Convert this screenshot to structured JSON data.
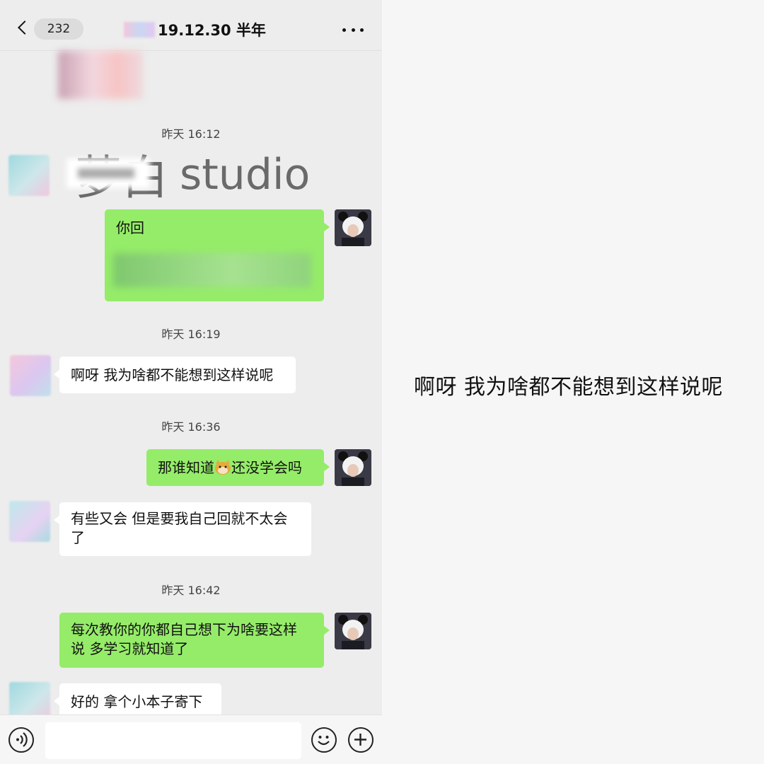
{
  "header": {
    "unread_count": "232",
    "title": "19.12.30 半年"
  },
  "sticker_text": "studio",
  "timestamps": [
    "昨天 16:12",
    "昨天 16:19",
    "昨天 16:36",
    "昨天 16:42"
  ],
  "messages": [
    {
      "side": "out",
      "text": "你回"
    },
    {
      "side": "in",
      "text": "啊呀 我为啥都不能想到这样说呢"
    },
    {
      "side": "out",
      "text_before_emoji": "那谁知道",
      "emoji": "doge-emoji",
      "text_after_emoji": "还没学会吗"
    },
    {
      "side": "in",
      "line1": "有些又会 但是要我自己回就不太会",
      "line2": "了"
    },
    {
      "side": "out",
      "line1": "每次教你的你都自己想下为啥要这样",
      "line2": "说 多学习就知道了"
    },
    {
      "side": "in",
      "text": "好的 拿个小本子寄下"
    }
  ],
  "quote": "啊呀 我为啥都不能想到这样说呢",
  "colors": {
    "chat_background": "#ededed",
    "outgoing_bubble": "#95ec69",
    "incoming_bubble": "#ffffff",
    "page_background": "#f6f6f6"
  },
  "icons": [
    "back-icon",
    "more-icon",
    "voice-icon",
    "emoji-icon",
    "plus-icon"
  ]
}
